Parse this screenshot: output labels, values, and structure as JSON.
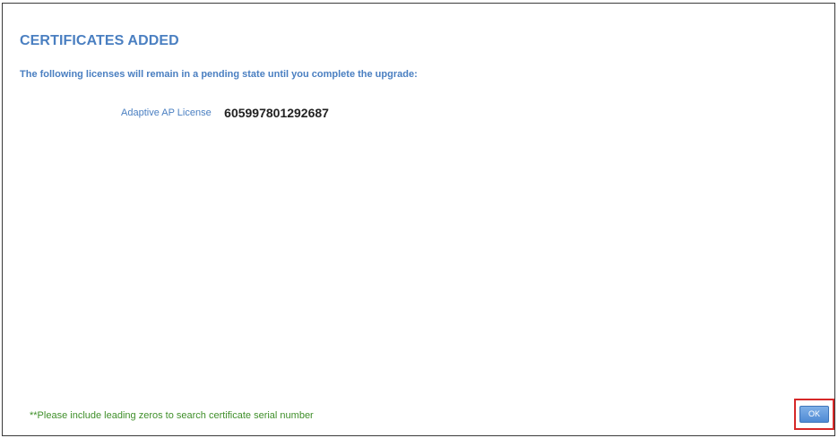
{
  "dialog": {
    "title": "CERTIFICATES ADDED",
    "message": "The following licenses will remain in a pending state until you complete the upgrade:",
    "licenses": [
      {
        "label": "Adaptive AP License",
        "serial": "605997801292687"
      }
    ],
    "footer_note": "**Please include leading zeros to search certificate serial number",
    "ok_label": "OK"
  },
  "colors": {
    "title": "#4a7fc1",
    "note": "#3f8f2a",
    "button": "#5b95d8",
    "highlight": "#d62828"
  }
}
